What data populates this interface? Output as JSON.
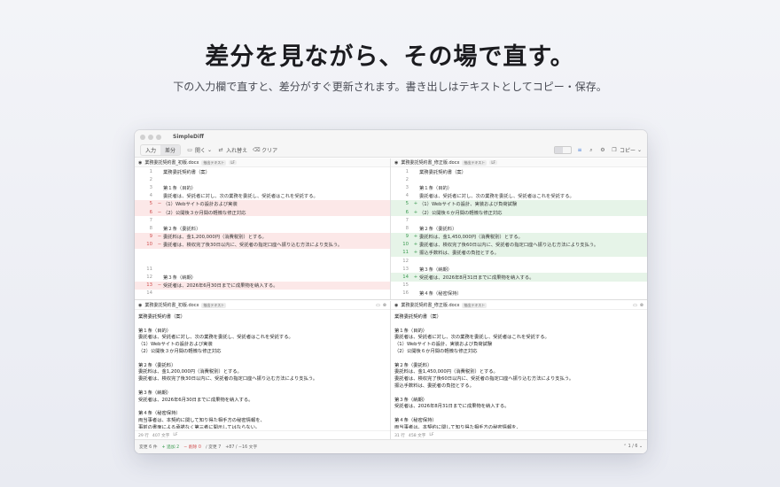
{
  "hero": {
    "title": "差分を見ながら、その場で直す。",
    "subtitle": "下の入力欄で直すと、差分がすぐ更新されます。書き出しはテキストとしてコピー・保存。"
  },
  "window": {
    "title": "SimpleDiff"
  },
  "toolbar": {
    "tab_input": "入力",
    "tab_diff": "差分",
    "open": "開く",
    "swap": "入れ替え",
    "clear": "クリア",
    "copy": "コピー"
  },
  "left_pane": {
    "filename": "業務委託契約書_初版.docx",
    "badge": "抽出テキスト",
    "badge2": "LF"
  },
  "right_pane": {
    "filename": "業務委託契約書_修正版.docx",
    "badge": "抽出テキスト",
    "badge2": "LF"
  },
  "left_lines": [
    {
      "n": "1",
      "m": "",
      "t": "業務委託契約書（案）",
      "k": ""
    },
    {
      "n": "2",
      "m": "",
      "t": "",
      "k": ""
    },
    {
      "n": "3",
      "m": "",
      "t": "第１条（目的）",
      "k": ""
    },
    {
      "n": "4",
      "m": "",
      "t": "委託者は、受託者に対し、次の業務を委託し、受託者はこれを受託する。",
      "k": ""
    },
    {
      "n": "5",
      "m": "−",
      "t": "（1）Webサイトの設計および実装",
      "k": "del"
    },
    {
      "n": "6",
      "m": "−",
      "t": "（2）公開後３か月間の軽微な修正対応",
      "k": "del"
    },
    {
      "n": "7",
      "m": "",
      "t": "",
      "k": ""
    },
    {
      "n": "8",
      "m": "",
      "t": "第２条（委託料）",
      "k": ""
    },
    {
      "n": "9",
      "m": "−",
      "t": "委託料は、金1,200,000円（消費税別）とする。",
      "k": "del"
    },
    {
      "n": "10",
      "m": "−",
      "t": "委託者は、検収完了後30日以内に、受託者の指定口座へ振り込む方法により支払う。",
      "k": "del"
    },
    {
      "n": "",
      "m": "",
      "t": "",
      "k": ""
    },
    {
      "n": "",
      "m": "",
      "t": "",
      "k": ""
    },
    {
      "n": "11",
      "m": "",
      "t": "",
      "k": ""
    },
    {
      "n": "12",
      "m": "",
      "t": "第３条（納期）",
      "k": ""
    },
    {
      "n": "13",
      "m": "−",
      "t": "受託者は、2026年6月30日までに成果物を納入する。",
      "k": "del"
    },
    {
      "n": "14",
      "m": "",
      "t": "",
      "k": ""
    },
    {
      "n": "15",
      "m": "",
      "t": "第４条（秘密保持）",
      "k": ""
    }
  ],
  "right_lines": [
    {
      "n": "1",
      "m": "",
      "t": "業務委託契約書（案）",
      "k": ""
    },
    {
      "n": "2",
      "m": "",
      "t": "",
      "k": ""
    },
    {
      "n": "3",
      "m": "",
      "t": "第１条（目的）",
      "k": ""
    },
    {
      "n": "4",
      "m": "",
      "t": "委託者は、受託者に対し、次の業務を委託し、受託者はこれを受託する。",
      "k": ""
    },
    {
      "n": "5",
      "m": "+",
      "t": "（1）Webサイトの設計、実装および負荷試験",
      "k": "add"
    },
    {
      "n": "6",
      "m": "+",
      "t": "（2）公開後６か月間の軽微な修正対応",
      "k": "add"
    },
    {
      "n": "7",
      "m": "",
      "t": "",
      "k": ""
    },
    {
      "n": "8",
      "m": "",
      "t": "第２条（委託料）",
      "k": ""
    },
    {
      "n": "9",
      "m": "+",
      "t": "委託料は、金1,450,000円（消費税別）とする。",
      "k": "add"
    },
    {
      "n": "10",
      "m": "+",
      "t": "委託者は、検収完了後60日以内に、受託者の指定口座へ振り込む方法により支払う。",
      "k": "add"
    },
    {
      "n": "11",
      "m": "+",
      "t": "振込手数料は、委託者の負担とする。",
      "k": "add"
    },
    {
      "n": "12",
      "m": "",
      "t": "",
      "k": ""
    },
    {
      "n": "13",
      "m": "",
      "t": "第３条（納期）",
      "k": ""
    },
    {
      "n": "14",
      "m": "+",
      "t": "受託者は、2026年8月31日までに成果物を納入する。",
      "k": "add"
    },
    {
      "n": "15",
      "m": "",
      "t": "",
      "k": ""
    },
    {
      "n": "16",
      "m": "",
      "t": "第４条（秘密保持）",
      "k": ""
    }
  ],
  "left_editor": {
    "filename": "業務委託契約書_初版.docx",
    "badge": "抽出テキスト",
    "lines": [
      "業務委託契約書（案）",
      "",
      "第１条（目的）",
      "委託者は、受託者に対し、次の業務を委託し、受託者はこれを受託する。",
      "（1）Webサイトの設計および実装",
      "（2）公開後３か月間の軽微な修正対応",
      "",
      "第２条（委託料）",
      "委託料は、金1,200,000円（消費税別）とする。",
      "委託者は、検収完了後30日以内に、受託者の指定口座へ振り込む方法により支払う。",
      "",
      "第３条（納期）",
      "受託者は、2026年6月30日までに成果物を納入する。",
      "",
      "第４条（秘密保持）",
      "両当事者は、本契約に関して知り得た相手方の秘密情報を、",
      "事前の書面による承諾なく第三者に開示してはならない。"
    ],
    "footer_lines": "29 行",
    "footer_chars": "407 文字",
    "footer_lf": "LF"
  },
  "right_editor": {
    "filename": "業務委託契約書_修正版.docx",
    "badge": "抽出テキスト",
    "lines": [
      "業務委託契約書（案）",
      "",
      "第１条（目的）",
      "委託者は、受託者に対し、次の業務を委託し、受託者はこれを受託する。",
      "（1）Webサイトの設計、実装および負荷試験",
      "（2）公開後６か月間の軽微な修正対応",
      "",
      "第２条（委託料）",
      "委託料は、金1,450,000円（消費税別）とする。",
      "委託者は、検収完了後60日以内に、受託者の指定口座へ振り込む方法により支払う。",
      "振込手数料は、委託者の負担とする。",
      "",
      "第３条（納期）",
      "受託者は、2026年8月31日までに成果物を納入する。",
      "",
      "第４条（秘密保持）",
      "両当事者は、本契約に関して知り得た相手方の秘密情報を、"
    ],
    "footer_lines": "31 行",
    "footer_chars": "458 文字",
    "footer_lf": "LF"
  },
  "status": {
    "changes": "変更 6 件",
    "added": "+ 追加 2",
    "deleted": "− 削除 0",
    "modified": "∕ 変更 7",
    "chars": "+87 / −16 文字",
    "nav": "1 / 6"
  },
  "colors": {
    "deleted_bg": "#fce8e8",
    "added_bg": "#e6f4e8",
    "accent": "#4a7fd8"
  }
}
